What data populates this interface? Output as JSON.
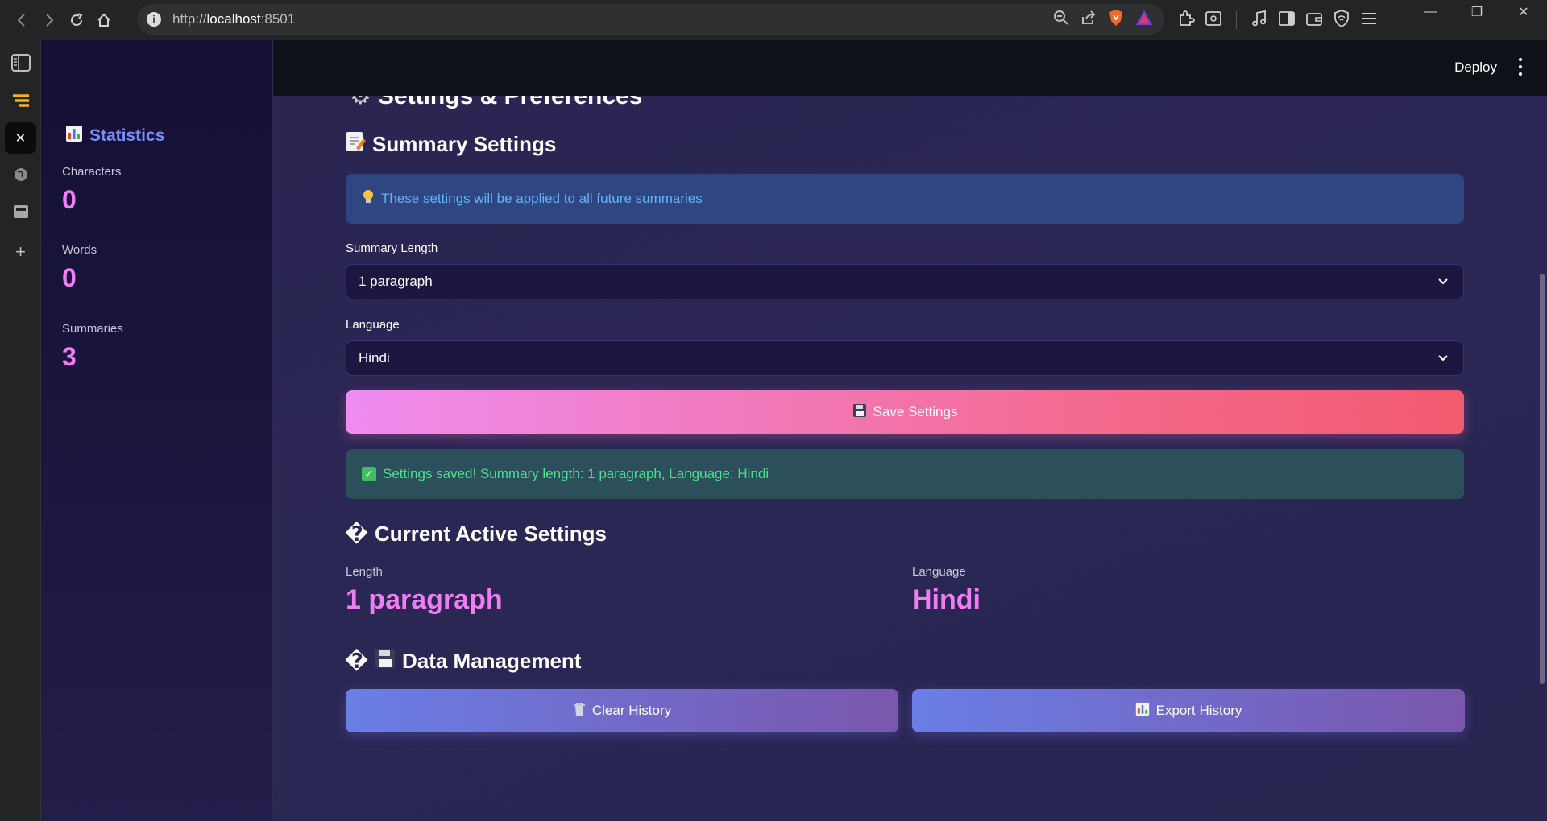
{
  "browser": {
    "url_prefix": "http://",
    "url_host": "localhost",
    "url_suffix": ":8501"
  },
  "header": {
    "deploy_label": "Deploy"
  },
  "sidebar": {
    "title": "Statistics",
    "stats": [
      {
        "label": "Characters",
        "value": "0"
      },
      {
        "label": "Words",
        "value": "0"
      },
      {
        "label": "Summaries",
        "value": "3"
      }
    ]
  },
  "main": {
    "page_title": "Settings & Preferences",
    "summary_settings_title": "Summary Settings",
    "info_text": "These settings will be applied to all future summaries",
    "summary_length_label": "Summary Length",
    "summary_length_value": "1 paragraph",
    "language_label": "Language",
    "language_value": "Hindi",
    "save_button_label": "Save Settings",
    "success_text": "Settings saved! Summary length: 1 paragraph, Language: Hindi",
    "current_settings_title": "Current Active Settings",
    "current_length_label": "Length",
    "current_length_value": "1 paragraph",
    "current_language_label": "Language",
    "current_language_value": "Hindi",
    "data_management_title": "Data Management",
    "clear_history_label": "Clear History",
    "export_history_label": "Export History",
    "broken_glyph": "�"
  },
  "colors": {
    "accent_pink": "#ef7ef2",
    "accent_blue": "#7a8cf5",
    "info_bg": "#2f4682",
    "success_bg": "#2c4f5c"
  }
}
